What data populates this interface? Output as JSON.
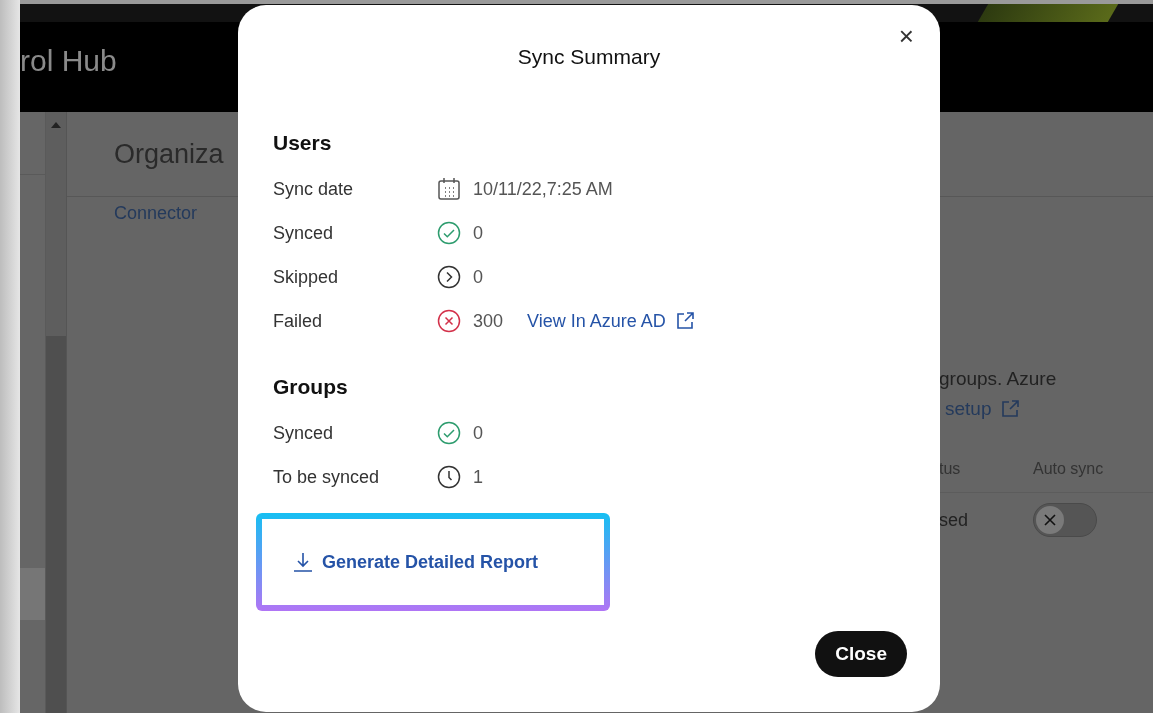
{
  "app": {
    "title": "rol Hub"
  },
  "page": {
    "title": "Organiza",
    "tabs": [
      {
        "label": "Connector",
        "selected": true
      }
    ],
    "description": "groups. Azure",
    "setup_link": "setup",
    "table": {
      "columns": [
        "tus",
        "Auto sync"
      ],
      "rows": [
        {
          "status": "sed",
          "auto_sync": false
        }
      ]
    }
  },
  "dialog": {
    "title": "Sync Summary",
    "close_icon": "×",
    "sections": [
      {
        "heading": "Users",
        "rows": [
          {
            "label": "Sync date",
            "kind": "calendar",
            "value": "10/11/22,7:25 AM"
          },
          {
            "label": "Synced",
            "kind": "check",
            "value": "0"
          },
          {
            "label": "Skipped",
            "kind": "skip",
            "value": "0"
          },
          {
            "label": "Failed",
            "kind": "error",
            "value": "300",
            "link": "View In Azure AD"
          }
        ]
      },
      {
        "heading": "Groups",
        "rows": [
          {
            "label": "Synced",
            "kind": "check",
            "value": "0"
          },
          {
            "label": "To be synced",
            "kind": "clock",
            "value": "1"
          }
        ]
      }
    ],
    "report_link": "Generate Detailed Report",
    "close_button": "Close"
  }
}
